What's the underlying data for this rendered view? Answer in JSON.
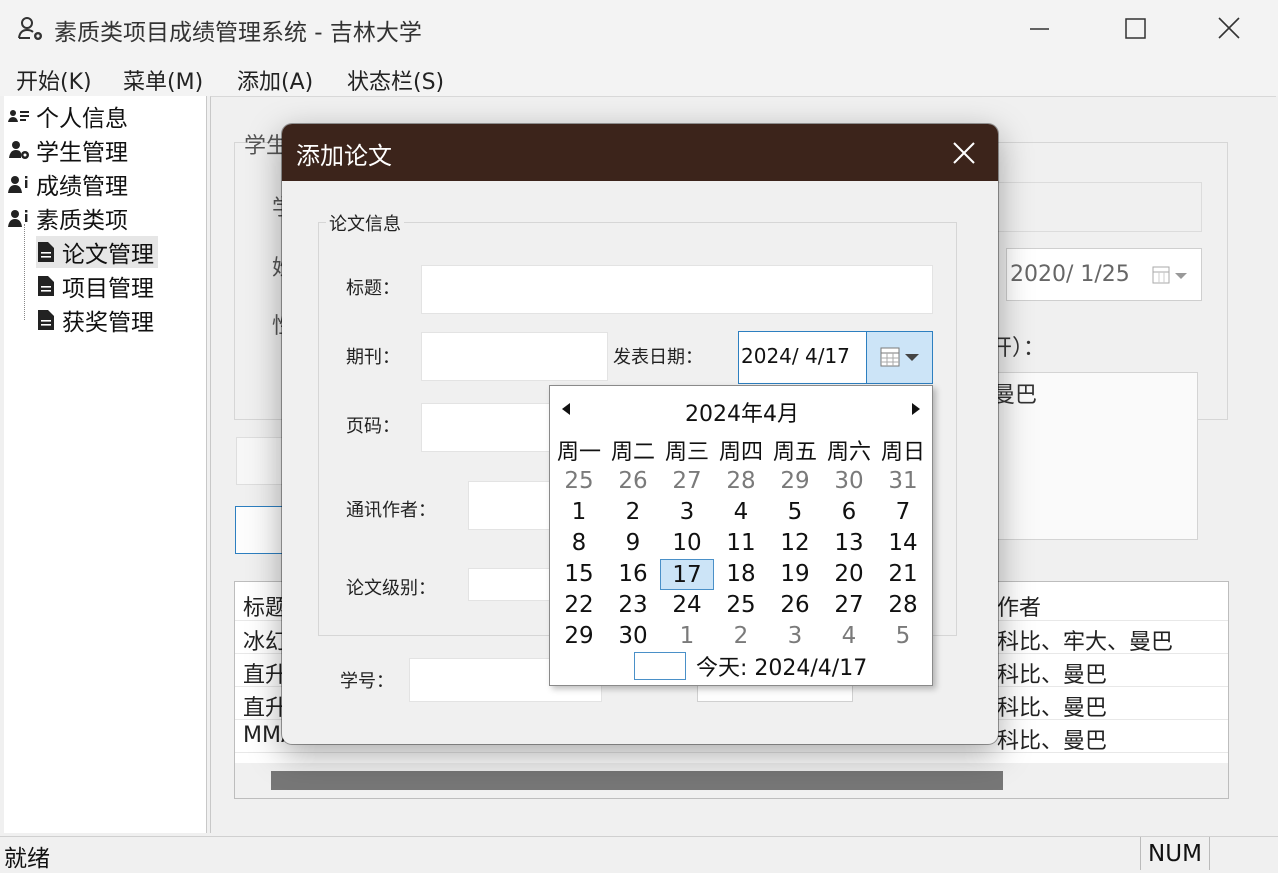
{
  "window": {
    "title": "素质类项目成绩管理系统 - 吉林大学"
  },
  "menu": {
    "items": [
      "开始(K)",
      "菜单(M)",
      "添加(A)",
      "状态栏(S)"
    ]
  },
  "tree": {
    "items": [
      {
        "label": "个人信息",
        "icon": "contact-card-icon"
      },
      {
        "label": "学生管理",
        "icon": "user-gear-icon"
      },
      {
        "label": "成绩管理",
        "icon": "user-info-icon"
      },
      {
        "label": "素质类项",
        "icon": "user-info-icon"
      },
      {
        "label": "论文管理",
        "icon": "document-icon"
      },
      {
        "label": "项目管理",
        "icon": "document-icon"
      },
      {
        "label": "获奖管理",
        "icon": "document-icon"
      }
    ]
  },
  "background": {
    "date_value": "2020/  1/25",
    "label_partial": "开）：",
    "text_partial": "曼巴",
    "table_header": [
      "标题",
      "作者"
    ],
    "table_rows": [
      [
        "冰幻",
        "科比、牢大、曼巴"
      ],
      [
        "直升",
        "科比、曼巴"
      ],
      [
        "直升",
        "科比、曼巴"
      ],
      [
        "MMA",
        "科比、曼巴"
      ]
    ]
  },
  "dialog": {
    "title": "添加论文",
    "group_title": "论文信息",
    "labels": {
      "title": "标题：",
      "journal": "期刊：",
      "publish_date": "发表日期：",
      "pages": "页码：",
      "corresponding_author": "通讯作者：",
      "paper_level": "论文级别：",
      "student_id": "学号："
    },
    "date_value": "2024/  4/17"
  },
  "calendar": {
    "month_title": "2024年4月",
    "weekdays": [
      "周一",
      "周二",
      "周三",
      "周四",
      "周五",
      "周六",
      "周日"
    ],
    "days": [
      [
        "25",
        "26",
        "27",
        "28",
        "29",
        "30",
        "31"
      ],
      [
        "1",
        "2",
        "3",
        "4",
        "5",
        "6",
        "7"
      ],
      [
        "8",
        "9",
        "10",
        "11",
        "12",
        "13",
        "14"
      ],
      [
        "15",
        "16",
        "17",
        "18",
        "19",
        "20",
        "21"
      ],
      [
        "22",
        "23",
        "24",
        "25",
        "26",
        "27",
        "28"
      ],
      [
        "29",
        "30",
        "1",
        "2",
        "3",
        "4",
        "5"
      ]
    ],
    "selected": "17",
    "today_label": "今天: 2024/4/17"
  },
  "status": {
    "ready": "就绪",
    "num": "NUM"
  },
  "colors": {
    "dialog_title_bg": "#3c241b",
    "selection": "#cce4f7",
    "accent_border": "#2d7fc0"
  }
}
